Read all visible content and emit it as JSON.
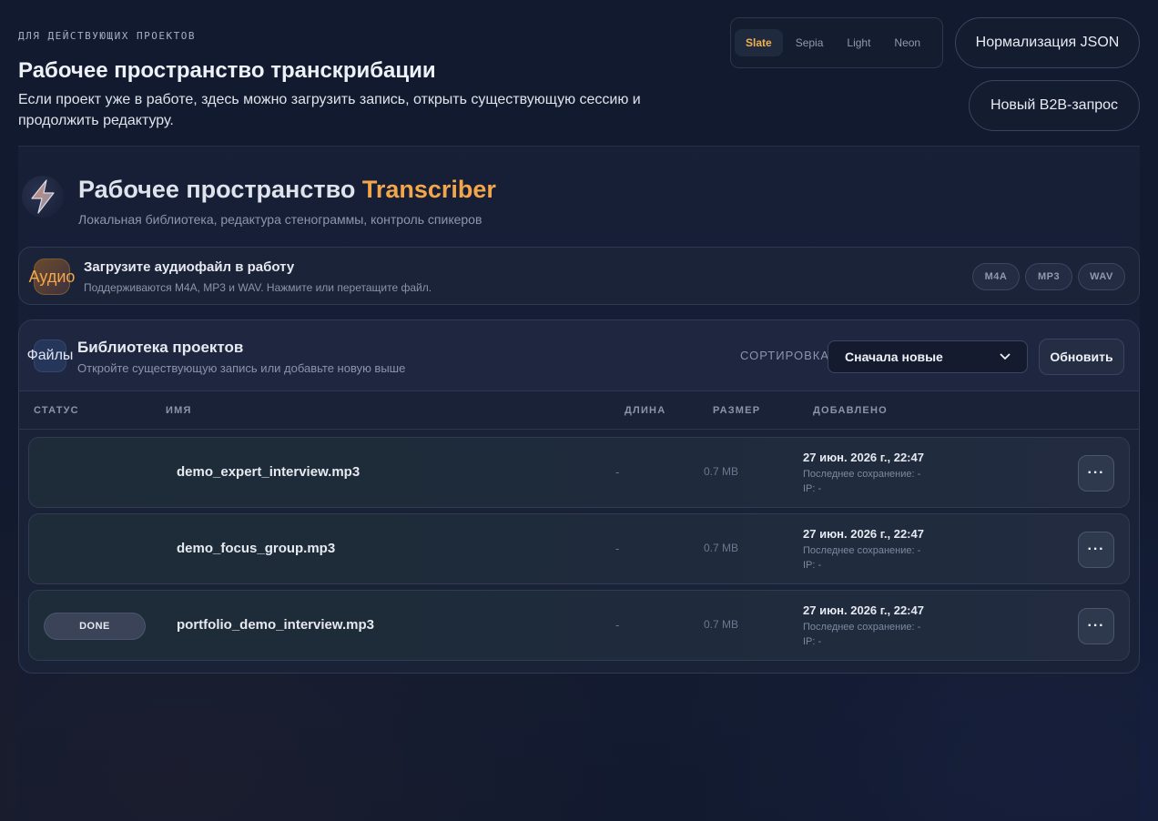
{
  "header": {
    "eyebrow": "ДЛЯ ДЕЙСТВУЮЩИХ ПРОЕКТОВ",
    "title": "Рабочее пространство транскрибации",
    "description": "Если проект уже в работе, здесь можно загрузить запись, открыть существующую сессию и продолжить редактуру."
  },
  "themes": {
    "options": [
      "Slate",
      "Sepia",
      "Light",
      "Neon"
    ],
    "active": "Slate"
  },
  "actions": {
    "json_label": "Нормализация JSON",
    "b2b_label": "Новый B2B-запрос"
  },
  "brand": {
    "title_main": "Рабочее пространство",
    "title_accent": "Transcriber",
    "subtitle": "Локальная библиотека, редактура стенограммы, контроль спикеров"
  },
  "upload": {
    "badge": "Аудио",
    "title": "Загрузите аудиофайл в работу",
    "subtitle": "Поддерживаются M4A, MP3 и WAV. Нажмите или перетащите файл.",
    "formats": [
      "M4A",
      "MP3",
      "WAV"
    ]
  },
  "library": {
    "badge": "Файлы",
    "title": "Библиотека проектов",
    "subtitle": "Откройте существующую запись или добавьте новую выше",
    "sort_label": "СОРТИРОВКА",
    "sort_value": "Сначала новые",
    "refresh_label": "Обновить",
    "columns": {
      "status": "СТАТУС",
      "name": "ИМЯ",
      "length": "ДЛИНА",
      "size": "РАЗМЕР",
      "added": "ДОБАВЛЕНО"
    },
    "rows": [
      {
        "status": "",
        "name": "demo_expert_interview.mp3",
        "length": "-",
        "size": "0.7 MB",
        "date": "27 июн. 2026 г., 22:47",
        "saved": "Последнее сохранение: -",
        "ip": "IP: -",
        "more": "···"
      },
      {
        "status": "",
        "name": "demo_focus_group.mp3",
        "length": "-",
        "size": "0.7 MB",
        "date": "27 июн. 2026 г., 22:47",
        "saved": "Последнее сохранение: -",
        "ip": "IP: -",
        "more": "···"
      },
      {
        "status": "DONE",
        "name": "portfolio_demo_interview.mp3",
        "length": "-",
        "size": "0.7 MB",
        "date": "27 июн. 2026 г., 22:47",
        "saved": "Последнее сохранение: -",
        "ip": "IP: -",
        "more": "···"
      }
    ]
  },
  "colors": {
    "accent": "#f3a64a",
    "background": "#111a2e"
  }
}
